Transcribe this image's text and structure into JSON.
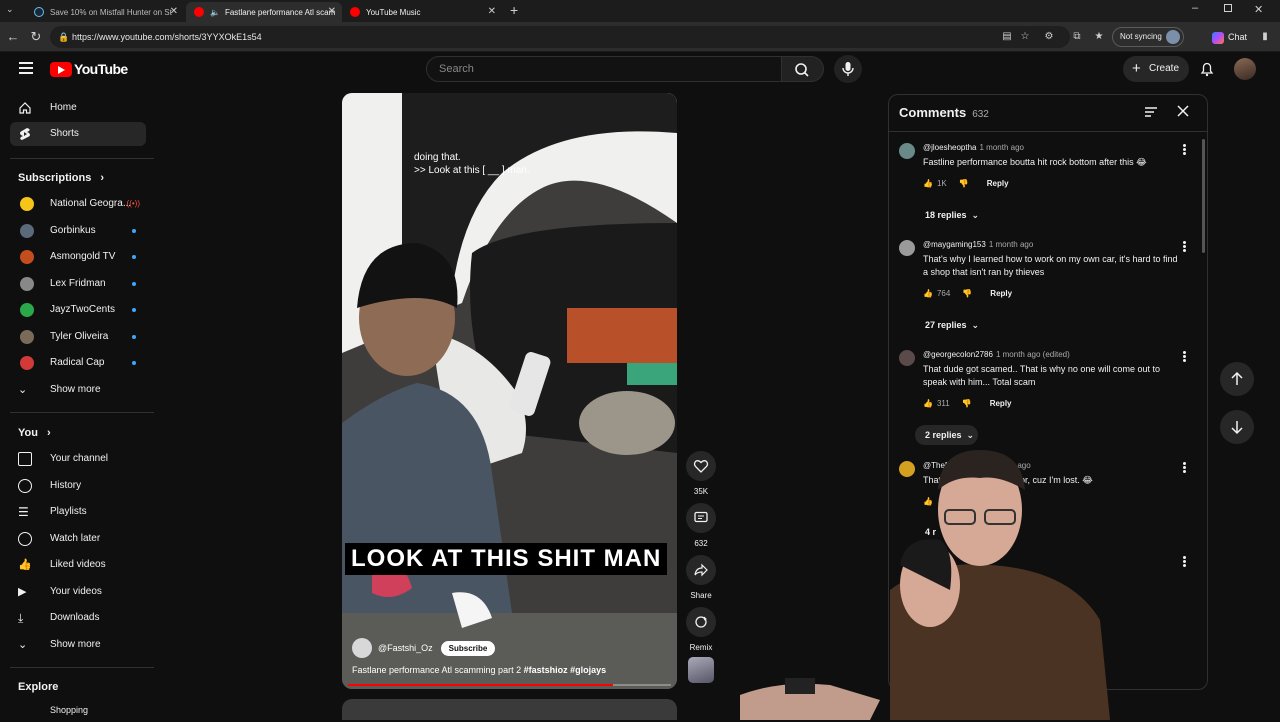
{
  "browser": {
    "tabs": [
      {
        "title": "Save 10% on Mistfall Hunter on St",
        "active": false,
        "color": "#1b2838"
      },
      {
        "title": "Fastlane performance Atl scam",
        "active": true,
        "color": "#ff0000"
      },
      {
        "title": "YouTube Music",
        "active": false,
        "color": "#ff0000"
      }
    ],
    "url": "https://www.youtube.com/shorts/3YYXOkE1s54",
    "sync_label": "Not syncing",
    "chat_label": "Chat"
  },
  "header": {
    "logo_text": "YouTube",
    "search_placeholder": "Search",
    "create_label": "Create"
  },
  "sidebar": {
    "main": [
      {
        "label": "Home",
        "icon": "home-icon"
      },
      {
        "label": "Shorts",
        "icon": "shorts-icon",
        "active": true
      }
    ],
    "subscriptions_heading": "Subscriptions",
    "subscriptions": [
      {
        "label": "National Geogra...",
        "color": "#f5c518",
        "live": true
      },
      {
        "label": "Gorbinkus",
        "color": "#5a6a7a"
      },
      {
        "label": "Asmongold TV",
        "color": "#c44d1e"
      },
      {
        "label": "Lex Fridman",
        "color": "#888888"
      },
      {
        "label": "JayzTwoCents",
        "color": "#2aa84a"
      },
      {
        "label": "Tyler Oliveira",
        "color": "#7a6a5a"
      },
      {
        "label": "Radical Cap",
        "color": "#d23a3a"
      }
    ],
    "subs_show_more": "Show more",
    "you_heading": "You",
    "you_items": [
      {
        "label": "Your channel",
        "icon": "your-channel-icon"
      },
      {
        "label": "History",
        "icon": "history-icon"
      },
      {
        "label": "Playlists",
        "icon": "playlists-icon"
      },
      {
        "label": "Watch later",
        "icon": "watch-later-icon"
      },
      {
        "label": "Liked videos",
        "icon": "liked-videos-icon"
      },
      {
        "label": "Your videos",
        "icon": "your-videos-icon"
      },
      {
        "label": "Downloads",
        "icon": "downloads-icon"
      }
    ],
    "you_show_more": "Show more",
    "explore_heading": "Explore",
    "explore_first": "Shopping"
  },
  "short": {
    "small_caption": "doing that.\n>> Look at this [ __ ] man.",
    "big_caption": "LOOK AT THIS SHIT MAN",
    "channel": "@Fastshi_Oz",
    "subscribe_label": "Subscribe",
    "title_text": "Fastlane performance Atl scamming part 2 ",
    "hashtags": "#fastshioz #glojays",
    "progress": 0.82
  },
  "actions": {
    "likes": "35K",
    "comments": "632",
    "share_label": "Share",
    "remix_label": "Remix"
  },
  "comments": {
    "title": "Comments",
    "count": "632",
    "items": [
      {
        "user": "@jloesheoptha",
        "time": "1 month ago",
        "text": "Fastline performance boutta hit rock bottom after this 😂",
        "likes": "1K",
        "replies": "18 replies",
        "color": "#6a8a8a"
      },
      {
        "user": "@maygaming153",
        "time": "1 month ago",
        "text": "That's why I learned how to work on my own car, it's hard to find a shop that isn't ran by thieves",
        "likes": "764",
        "replies": "27 replies",
        "color": "#9a9a9a"
      },
      {
        "user": "@georgecolon2786",
        "time": "1 month ago (edited)",
        "text": "That dude got scamed.. That is why no one will come out to speak with him... Total scam",
        "likes": "311",
        "replies": "2 replies",
        "color": "#5a4a4a"
      },
      {
        "user": "@TheN",
        "time": "h ago",
        "text": "That   tta call my supervisor, cuz I'm lost. 😂",
        "likes": "",
        "replies": "4 r",
        "color": "#d4a020"
      }
    ],
    "reply_label": "Reply"
  }
}
